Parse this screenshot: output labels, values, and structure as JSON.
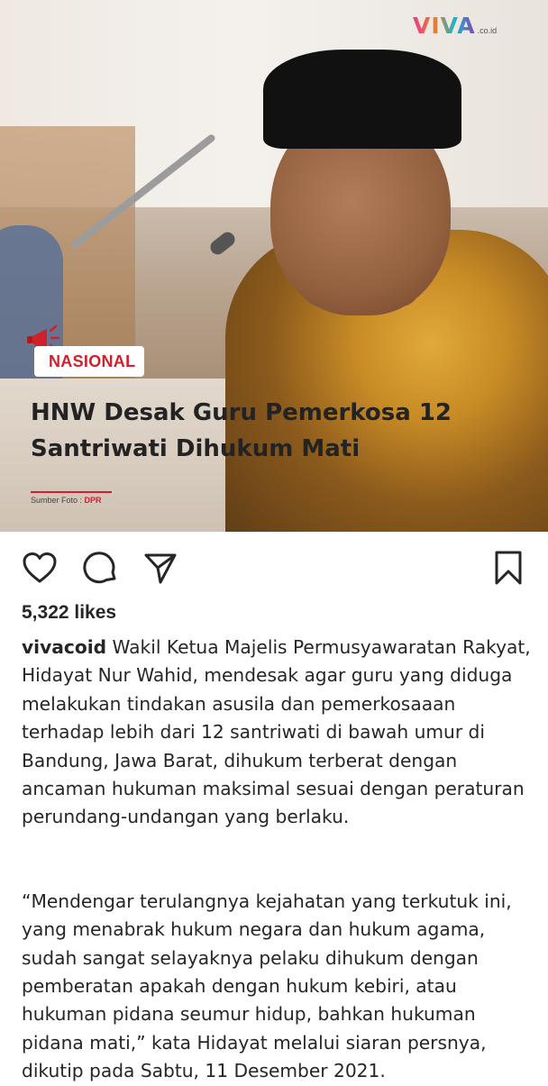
{
  "post": {
    "brand": {
      "name": "VIVA",
      "domain": ".co.id"
    },
    "category": "NASIONAL",
    "headline": "HNW Desak Guru Pemerkosa 12 Santriwati Dihukum Mati",
    "source_label": "Sumber Foto :",
    "source_name": "DPR",
    "accent_color": "#d0202a"
  },
  "actions": {
    "like_icon": "heart-icon",
    "comment_icon": "comment-icon",
    "share_icon": "send-icon",
    "save_icon": "bookmark-icon"
  },
  "likes": "5,322 likes",
  "caption": {
    "username": "vivacoid",
    "paragraph1": "Wakil Ketua Majelis Permusyawaratan Rakyat, Hidayat Nur Wahid, mendesak agar guru yang diduga melakukan tindakan asusila dan pemerkosaaan terhadap lebih dari 12 santriwati di bawah umur di Bandung, Jawa Barat, dihukum terberat dengan ancaman hukuman maksimal sesuai dengan peraturan perundang-undangan yang berlaku.",
    "paragraph2": "“Mendengar terulangnya kejahatan yang terkutuk ini, yang menabrak hukum negara dan hukum agama, sudah sangat selayaknya pelaku dihukum dengan pemberatan apakah dengan hukum kebiri, atau hukuman pidana seumur hidup, bahkan hukuman pidana mati,” kata Hidayat melalui siaran persnya, dikutip pada Sabtu, 11 Desember 2021."
  }
}
